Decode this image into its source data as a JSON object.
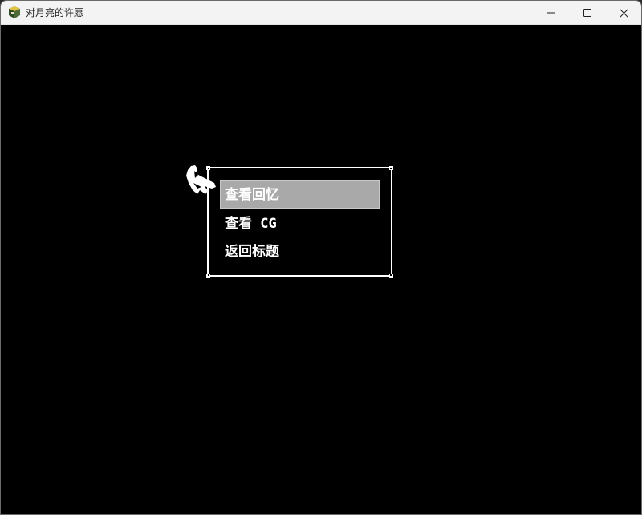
{
  "window": {
    "title": "对月亮的许愿",
    "app_icon": "game-app-icon",
    "controls": {
      "minimize_icon": "minimize-icon",
      "maximize_icon": "maximize-icon",
      "close_icon": "close-icon"
    }
  },
  "menu": {
    "items": [
      {
        "label": "查看回忆",
        "selected": true
      },
      {
        "label": "查看 CG",
        "selected": false
      },
      {
        "label": "返回标题",
        "selected": false
      }
    ],
    "pointer_icon": "pointing-hand-icon"
  },
  "colors": {
    "background": "#000000",
    "menu_border": "#ffffff",
    "menu_text": "#ffffff",
    "selection_highlight": "#a9a9a9",
    "titlebar": "#f3f3f3"
  }
}
